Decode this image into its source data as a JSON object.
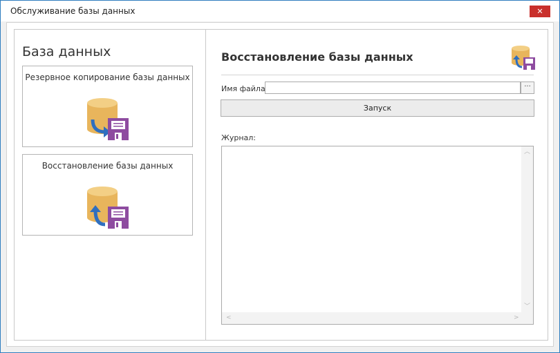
{
  "window": {
    "title": "Обслуживание базы данных",
    "close_glyph": "✕"
  },
  "left_panel": {
    "title": "База данных",
    "tiles": [
      {
        "label": "Резервное копирование базы данных",
        "icon": "database-backup-icon"
      },
      {
        "label": "Восстановление базы данных",
        "icon": "database-restore-icon"
      }
    ]
  },
  "right_panel": {
    "title": "Восстановление базы данных",
    "icon": "database-restore-icon",
    "file_label": "Имя файла:",
    "file_value": "",
    "browse_label": "···",
    "run_label": "Запуск",
    "log_label": "Журнал:",
    "log_text": ""
  },
  "scroll": {
    "up": "︿",
    "down": "﹀",
    "left": "<",
    "right": ">"
  },
  "colors": {
    "db_gold": "#e8b55c",
    "db_top": "#f3cf85",
    "disk_purple": "#8e4ca0",
    "arrow_blue": "#2f6fbf",
    "close_red": "#c9302c"
  }
}
